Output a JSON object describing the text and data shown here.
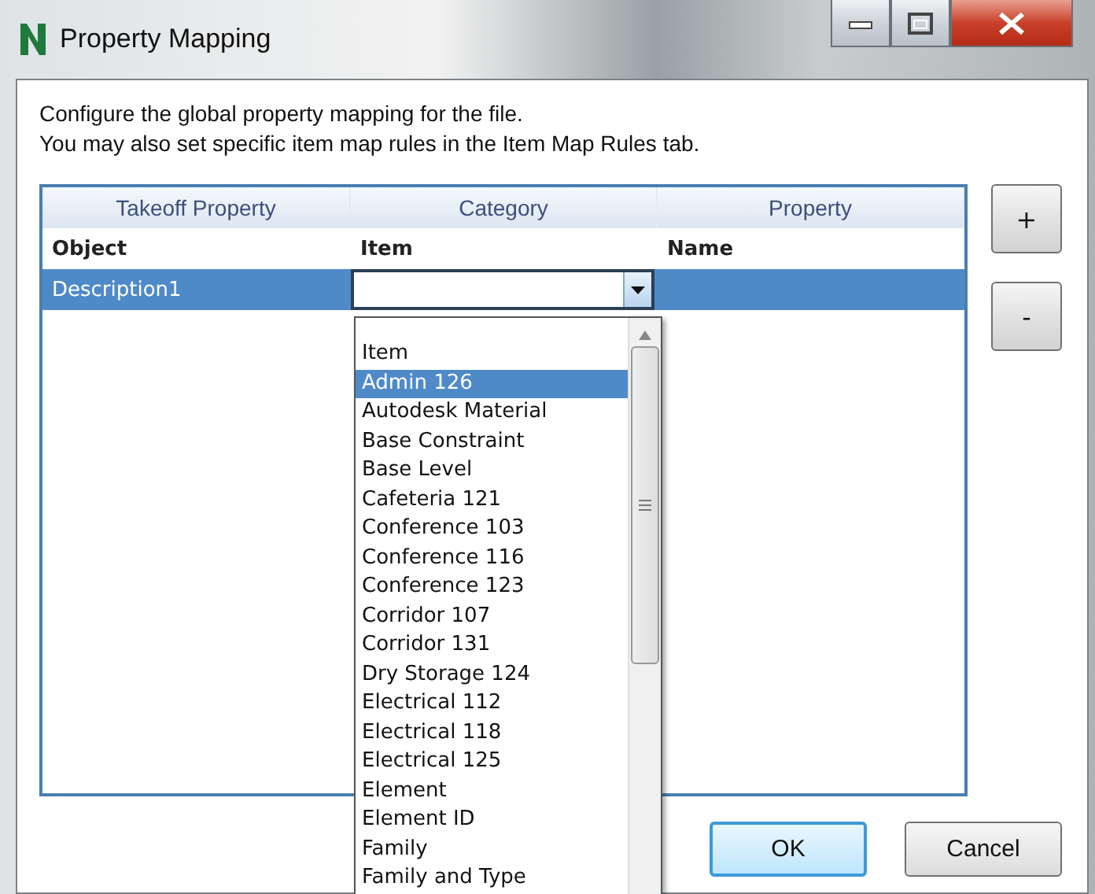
{
  "window": {
    "title": "Property Mapping"
  },
  "instructions": [
    "Configure the global property mapping for the file.",
    "You may also set specific item map rules in the Item Map Rules tab."
  ],
  "table": {
    "columns": [
      "Takeoff Property",
      "Category",
      "Property"
    ],
    "group_row": [
      "Object",
      "Item",
      "Name"
    ],
    "rows": [
      {
        "cells": [
          "Description1",
          "",
          ""
        ],
        "selected": true
      }
    ]
  },
  "dropdown": {
    "expanded": true,
    "items": [
      {
        "label": "Item",
        "selected": false
      },
      {
        "label": "Admin 126",
        "selected": true
      },
      {
        "label": "Autodesk Material",
        "selected": false
      },
      {
        "label": "Base Constraint",
        "selected": false
      },
      {
        "label": "Base Level",
        "selected": false
      },
      {
        "label": "Cafeteria 121",
        "selected": false
      },
      {
        "label": "Conference 103",
        "selected": false
      },
      {
        "label": "Conference 116",
        "selected": false
      },
      {
        "label": "Conference 123",
        "selected": false
      },
      {
        "label": "Corridor 107",
        "selected": false
      },
      {
        "label": "Corridor 131",
        "selected": false
      },
      {
        "label": "Dry Storage 124",
        "selected": false
      },
      {
        "label": "Electrical 112",
        "selected": false
      },
      {
        "label": "Electrical 118",
        "selected": false
      },
      {
        "label": "Electrical 125",
        "selected": false
      },
      {
        "label": "Element",
        "selected": false
      },
      {
        "label": "Element ID",
        "selected": false
      },
      {
        "label": "Family",
        "selected": false
      },
      {
        "label": "Family and Type",
        "selected": false
      }
    ]
  },
  "side_buttons": [
    "+",
    "-"
  ],
  "buttons": [
    {
      "label": "OK",
      "default": true
    },
    {
      "label": "Cancel",
      "default": false
    }
  ]
}
